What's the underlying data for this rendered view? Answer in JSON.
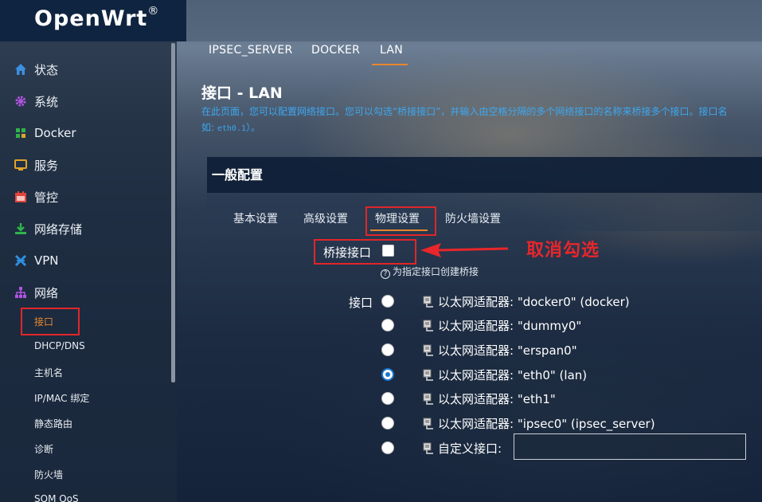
{
  "brand": {
    "name": "OpenWrt",
    "reg": "®"
  },
  "sidebar": {
    "items": [
      {
        "label": "状态",
        "icon": "home-icon",
        "color": "#3d8fe0"
      },
      {
        "label": "系统",
        "icon": "gear-icon",
        "color": "#b055e0"
      },
      {
        "label": "Docker",
        "icon": "docker-grid-icon",
        "color": "#2fb34a"
      },
      {
        "label": "服务",
        "icon": "services-icon",
        "color": "#e0a32a"
      },
      {
        "label": "管控",
        "icon": "calendar-icon",
        "color": "#e0443a"
      },
      {
        "label": "网络存储",
        "icon": "download-icon",
        "color": "#2fb34a"
      },
      {
        "label": "VPN",
        "icon": "vpn-icon",
        "color": "#2f8fe0"
      },
      {
        "label": "网络",
        "icon": "network-icon",
        "color": "#b055e0"
      }
    ],
    "subitems": [
      {
        "label": "接口",
        "active": true
      },
      {
        "label": "DHCP/DNS"
      },
      {
        "label": "主机名"
      },
      {
        "label": "IP/MAC 绑定"
      },
      {
        "label": "静态路由"
      },
      {
        "label": "诊断"
      },
      {
        "label": "防火墙"
      },
      {
        "label": "SQM QoS"
      }
    ]
  },
  "top_tabs": [
    {
      "label": "IPSEC_SERVER"
    },
    {
      "label": "DOCKER"
    },
    {
      "label": "LAN",
      "active": true
    }
  ],
  "page": {
    "title": "接口 - LAN",
    "description": "在此页面，您可以配置网络接口。您可以勾选“桥接接口”，并输入由空格分隔的多个网络接口的名称来桥接多个接口。接口名",
    "description_example_prefix": "如: ",
    "description_example_code": "eth0.1",
    "description_example_suffix": "）。"
  },
  "section": {
    "title": "一般配置",
    "tabs": [
      {
        "label": "基本设置"
      },
      {
        "label": "高级设置"
      },
      {
        "label": "物理设置",
        "active": true
      },
      {
        "label": "防火墙设置"
      }
    ]
  },
  "bridge": {
    "label": "桥接接口",
    "checked": false,
    "help": "为指定接口创建桥接",
    "annotation": "取消勾选"
  },
  "interface": {
    "label": "接口",
    "options": [
      {
        "label": "以太网适配器: \"docker0\" (docker)",
        "selected": false
      },
      {
        "label": "以太网适配器: \"dummy0\"",
        "selected": false
      },
      {
        "label": "以太网适配器: \"erspan0\"",
        "selected": false
      },
      {
        "label": "以太网适配器: \"eth0\" (lan)",
        "selected": true
      },
      {
        "label": "以太网适配器: \"eth1\"",
        "selected": false
      },
      {
        "label": "以太网适配器: \"ipsec0\" (ipsec_server)",
        "selected": false
      },
      {
        "label": "自定义接口:",
        "selected": false,
        "custom": true
      }
    ],
    "custom_value": ""
  },
  "colors": {
    "accent": "#e8862c",
    "highlight_red": "#e0262a",
    "link_blue": "#3da7f0",
    "radio_blue": "#1976d2"
  }
}
